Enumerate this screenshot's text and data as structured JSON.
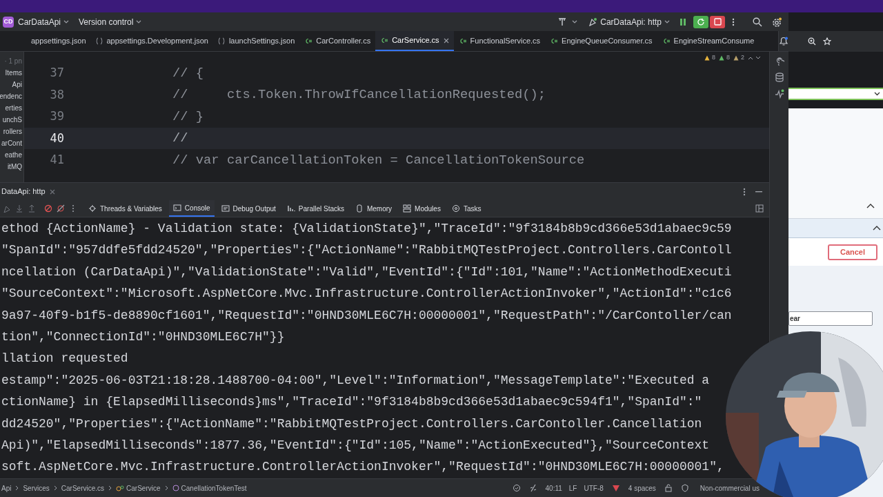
{
  "toolbar": {
    "project_badge": "CD",
    "project": "CarDataApi",
    "vcs": "Version control",
    "run_config": "CarDataApi: http"
  },
  "tabs": [
    {
      "label": "appsettings.json",
      "kind": "plain",
      "selected": false
    },
    {
      "label": "appsettings.Development.json",
      "kind": "json",
      "selected": false
    },
    {
      "label": "launchSettings.json",
      "kind": "json",
      "selected": false
    },
    {
      "label": "CarController.cs",
      "kind": "cs",
      "selected": false
    },
    {
      "label": "CarService.cs",
      "kind": "cs",
      "selected": true
    },
    {
      "label": "FunctionalService.cs",
      "kind": "cs",
      "selected": false
    },
    {
      "label": "EngineQueueConsumer.cs",
      "kind": "cs",
      "selected": false
    },
    {
      "label": "EngineStreamConsume",
      "kind": "cs",
      "selected": false
    }
  ],
  "project_tree": [
    "· 1 pn",
    "Items",
    "Api",
    "endenc",
    "erties",
    "unchS",
    "rollers",
    "arCont",
    "eathe",
    "itMQ"
  ],
  "editor": {
    "inspections": [
      {
        "kind": "warning",
        "count": "8"
      },
      {
        "kind": "ok",
        "count": "8"
      },
      {
        "kind": "weak",
        "count": "2"
      }
    ],
    "lines": [
      {
        "number": "37",
        "code": "// {",
        "current": false
      },
      {
        "number": "38",
        "code": "//     cts.Token.ThrowIfCancellationRequested();",
        "current": false
      },
      {
        "number": "39",
        "code": "// }",
        "current": false
      },
      {
        "number": "40",
        "code": "//",
        "current": true
      },
      {
        "number": "41",
        "code": "// var carCancellationToken = CancellationTokenSource",
        "current": false
      }
    ]
  },
  "debug": {
    "session_tab": "DataApi: http",
    "tabs": [
      {
        "label": "Threads & Variables",
        "selected": false
      },
      {
        "label": "Console",
        "selected": true
      },
      {
        "label": "Debug Output",
        "selected": false
      },
      {
        "label": "Parallel Stacks",
        "selected": false
      },
      {
        "label": "Memory",
        "selected": false
      },
      {
        "label": "Modules",
        "selected": false
      },
      {
        "label": "Tasks",
        "selected": false
      }
    ],
    "console_lines": [
      "ethod {ActionName} - Validation state: {ValidationState}\",\"TraceId\":\"9f3184b8b9cd366e53d1abaec9c59",
      "\"SpanId\":\"957ddfe5fdd24520\",\"Properties\":{\"ActionName\":\"RabbitMQTestProject.Controllers.CarContoll",
      "ncellation (CarDataApi)\",\"ValidationState\":\"Valid\",\"EventId\":{\"Id\":101,\"Name\":\"ActionMethodExecuti",
      "\"SourceContext\":\"Microsoft.AspNetCore.Mvc.Infrastructure.ControllerActionInvoker\",\"ActionId\":\"c1c6",
      "9a97-40f9-b1f5-de8890cf1601\",\"RequestId\":\"0HND30MLE6C7H:00000001\",\"RequestPath\":\"/CarContoller/can",
      "tion\",\"ConnectionId\":\"0HND30MLE6C7H\"}}",
      "llation requested",
      "estamp\":\"2025-06-03T21:18:28.1488700-04:00\",\"Level\":\"Information\",\"MessageTemplate\":\"Executed a",
      "ctionName} in {ElapsedMilliseconds}ms\",\"TraceId\":\"9f3184b8b9cd366e53d1abaec9c594f1\",\"SpanId\":\"",
      "dd24520\",\"Properties\":{\"ActionName\":\"RabbitMQTestProject.Controllers.CarContoller.Cancellation",
      "Api)\",\"ElapsedMilliseconds\":1877.36,\"EventId\":{\"Id\":105,\"Name\":\"ActionExecuted\"},\"SourceContext",
      "soft.AspNetCore.Mvc.Infrastructure.ControllerActionInvoker\",\"RequestId\":\"0HND30MLE6C7H:00000001\","
    ]
  },
  "browser": {
    "cancel_button": "Cancel",
    "input_value": "ear"
  },
  "status_bar": {
    "breadcrumbs": [
      {
        "label": "Api",
        "kind": "plain"
      },
      {
        "label": "Services",
        "kind": "plain"
      },
      {
        "label": "CarService.cs",
        "kind": "file"
      },
      {
        "label": "CarService",
        "kind": "class"
      },
      {
        "label": "CanellationTokenTest",
        "kind": "method"
      }
    ],
    "position": "40:11",
    "line_ending": "LF",
    "encoding": "UTF-8",
    "indent": "4 spaces",
    "license": "Non-commercial us"
  }
}
